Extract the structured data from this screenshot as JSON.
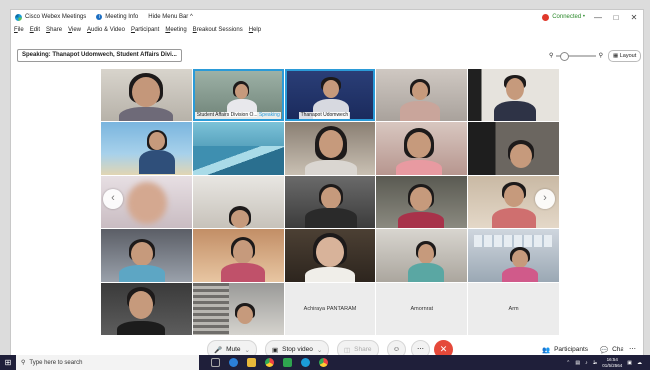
{
  "window": {
    "app_title": "Cisco Webex Meetings",
    "meeting_info": "Meeting Info",
    "hide_menu": "Hide Menu Bar ^",
    "status": "Connected •",
    "win_min": "—",
    "win_max": "□",
    "win_close": "✕"
  },
  "menu": [
    "File",
    "Edit",
    "Share",
    "View",
    "Audio & Video",
    "Participant",
    "Meeting",
    "Breakout Sessions",
    "Help"
  ],
  "toolbar": {
    "speaking": "Speaking: Thanapot Udomwech, Student Affairs Divi...",
    "layout_label": "Layout"
  },
  "participants": [
    {
      "name": ""
    },
    {
      "name": "Student Affairs Division O...",
      "status": "Speaking"
    },
    {
      "name": "Thanapot Udomwech"
    },
    {
      "name": ""
    },
    {
      "name": ""
    },
    {
      "name": ""
    },
    {
      "name": ""
    },
    {
      "name": ""
    },
    {
      "name": ""
    },
    {
      "name": ""
    },
    {
      "name": ""
    },
    {
      "name": ""
    },
    {
      "name": ""
    },
    {
      "name": ""
    },
    {
      "name": ""
    },
    {
      "name": ""
    },
    {
      "name": ""
    },
    {
      "name": ""
    },
    {
      "name": ""
    },
    {
      "name": ""
    },
    {
      "name": ""
    },
    {
      "name": ""
    },
    {
      "name": "Achiraya PANTARAM"
    },
    {
      "name": "Amornrat"
    },
    {
      "name": "Arm"
    }
  ],
  "controls": {
    "mute": "Mute",
    "stop_video": "Stop video",
    "share": "Share",
    "participants": "Participants",
    "chat": "Chat"
  },
  "taskbar": {
    "search_placeholder": "Type here to search",
    "time": "16:54",
    "date": "01/5/2564"
  },
  "colors": {
    "accent": "#2b9bd8",
    "end_meeting": "#e5493a",
    "taskbar": "#1f1f3a"
  }
}
